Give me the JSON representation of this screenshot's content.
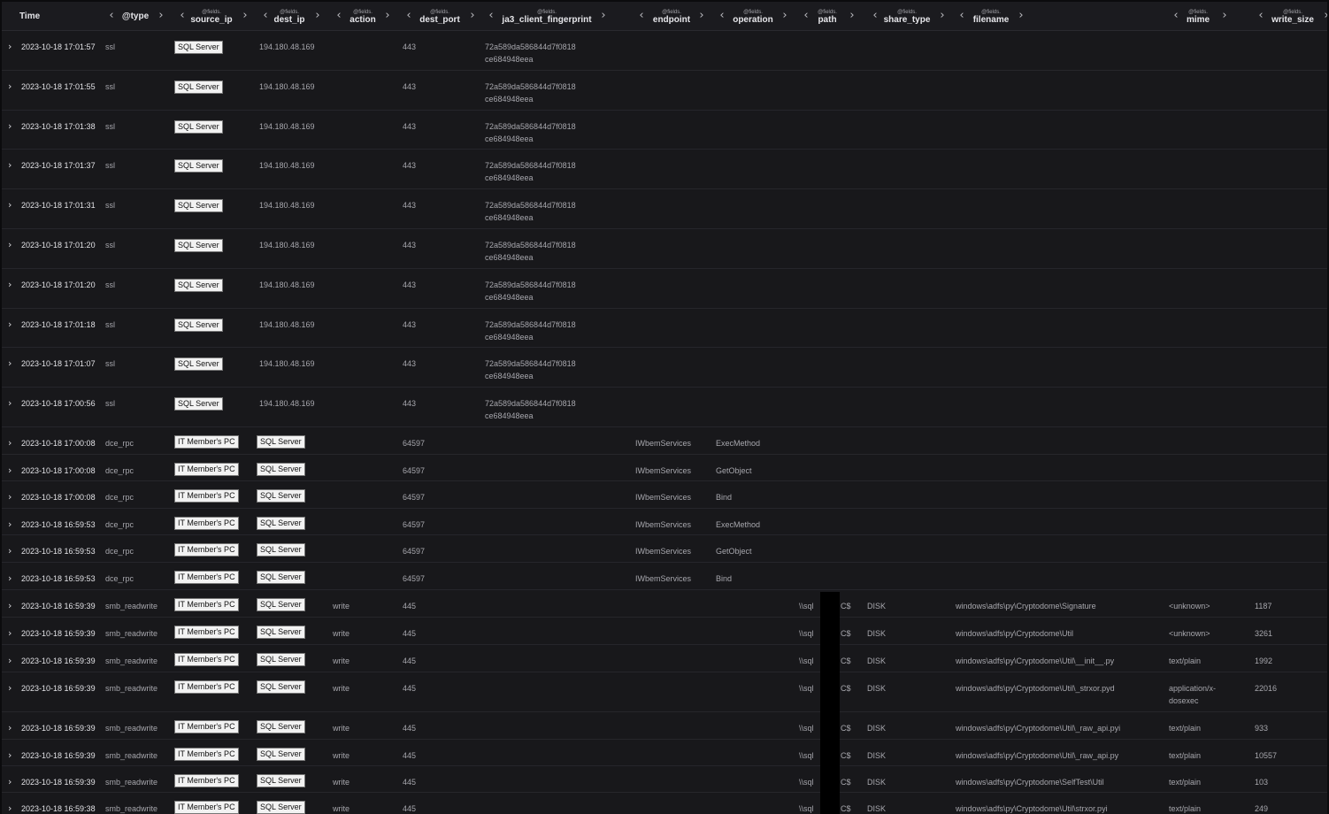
{
  "columns": [
    {
      "prefix": "",
      "name": "Time"
    },
    {
      "prefix": "",
      "name": "@type"
    },
    {
      "prefix": "@fields.",
      "name": "source_ip"
    },
    {
      "prefix": "@fields.",
      "name": "dest_ip"
    },
    {
      "prefix": "@fields.",
      "name": "action"
    },
    {
      "prefix": "@fields.",
      "name": "dest_port"
    },
    {
      "prefix": "@fields.",
      "name": "ja3_client_fingerprint"
    },
    {
      "prefix": "@fields.",
      "name": "endpoint"
    },
    {
      "prefix": "@fields.",
      "name": "operation"
    },
    {
      "prefix": "@fields.",
      "name": "path"
    },
    {
      "prefix": "@fields.",
      "name": "share_type"
    },
    {
      "prefix": "@fields.",
      "name": "filename"
    },
    {
      "prefix": "@fields.",
      "name": "mime"
    },
    {
      "prefix": "@fields.",
      "name": "write_size"
    }
  ],
  "ssl_rows": [
    {
      "time": "2023-10-18 17:01:57",
      "type": "ssl",
      "source": "SQL Server",
      "dest_ip": "194.180.48.169",
      "port": "443",
      "fp1": "72a589da586844d7f0818",
      "fp2": "ce684948eea"
    },
    {
      "time": "2023-10-18 17:01:55",
      "type": "ssl",
      "source": "SQL Server",
      "dest_ip": "194.180.48.169",
      "port": "443",
      "fp1": "72a589da586844d7f0818",
      "fp2": "ce684948eea"
    },
    {
      "time": "2023-10-18 17:01:38",
      "type": "ssl",
      "source": "SQL Server",
      "dest_ip": "194.180.48.169",
      "port": "443",
      "fp1": "72a589da586844d7f0818",
      "fp2": "ce684948eea"
    },
    {
      "time": "2023-10-18 17:01:37",
      "type": "ssl",
      "source": "SQL Server",
      "dest_ip": "194.180.48.169",
      "port": "443",
      "fp1": "72a589da586844d7f0818",
      "fp2": "ce684948eea"
    },
    {
      "time": "2023-10-18 17:01:31",
      "type": "ssl",
      "source": "SQL Server",
      "dest_ip": "194.180.48.169",
      "port": "443",
      "fp1": "72a589da586844d7f0818",
      "fp2": "ce684948eea"
    },
    {
      "time": "2023-10-18 17:01:20",
      "type": "ssl",
      "source": "SQL Server",
      "dest_ip": "194.180.48.169",
      "port": "443",
      "fp1": "72a589da586844d7f0818",
      "fp2": "ce684948eea"
    },
    {
      "time": "2023-10-18 17:01:20",
      "type": "ssl",
      "source": "SQL Server",
      "dest_ip": "194.180.48.169",
      "port": "443",
      "fp1": "72a589da586844d7f0818",
      "fp2": "ce684948eea"
    },
    {
      "time": "2023-10-18 17:01:18",
      "type": "ssl",
      "source": "SQL Server",
      "dest_ip": "194.180.48.169",
      "port": "443",
      "fp1": "72a589da586844d7f0818",
      "fp2": "ce684948eea"
    },
    {
      "time": "2023-10-18 17:01:07",
      "type": "ssl",
      "source": "SQL Server",
      "dest_ip": "194.180.48.169",
      "port": "443",
      "fp1": "72a589da586844d7f0818",
      "fp2": "ce684948eea"
    },
    {
      "time": "2023-10-18 17:00:56",
      "type": "ssl",
      "source": "SQL Server",
      "dest_ip": "194.180.48.169",
      "port": "443",
      "fp1": "72a589da586844d7f0818",
      "fp2": "ce684948eea"
    }
  ],
  "rpc_rows": [
    {
      "time": "2023-10-18 17:00:08",
      "type": "dce_rpc",
      "source": "IT Member's PC",
      "dest": "SQL Server",
      "port": "64597",
      "endpoint": "IWbemServices",
      "operation": "ExecMethod"
    },
    {
      "time": "2023-10-18 17:00:08",
      "type": "dce_rpc",
      "source": "IT Member's PC",
      "dest": "SQL Server",
      "port": "64597",
      "endpoint": "IWbemServices",
      "operation": "GetObject"
    },
    {
      "time": "2023-10-18 17:00:08",
      "type": "dce_rpc",
      "source": "IT Member's PC",
      "dest": "SQL Server",
      "port": "64597",
      "endpoint": "IWbemServices",
      "operation": "Bind"
    },
    {
      "time": "2023-10-18 16:59:53",
      "type": "dce_rpc",
      "source": "IT Member's PC",
      "dest": "SQL Server",
      "port": "64597",
      "endpoint": "IWbemServices",
      "operation": "ExecMethod"
    },
    {
      "time": "2023-10-18 16:59:53",
      "type": "dce_rpc",
      "source": "IT Member's PC",
      "dest": "SQL Server",
      "port": "64597",
      "endpoint": "IWbemServices",
      "operation": "GetObject"
    },
    {
      "time": "2023-10-18 16:59:53",
      "type": "dce_rpc",
      "source": "IT Member's PC",
      "dest": "SQL Server",
      "port": "64597",
      "endpoint": "IWbemServices",
      "operation": "Bind"
    }
  ],
  "smb_rows": [
    {
      "time": "2023-10-18 16:59:39",
      "type": "smb_readwrite",
      "source": "IT Member's PC",
      "dest": "SQL Server",
      "action": "write",
      "port": "445",
      "path_a": "\\\\sql",
      "path_b": "C$",
      "share": "DISK",
      "filename": "windows\\adfs\\py\\Cryptodome\\Signature",
      "mime1": "<unknown>",
      "mime2": "",
      "size": "1187"
    },
    {
      "time": "2023-10-18 16:59:39",
      "type": "smb_readwrite",
      "source": "IT Member's PC",
      "dest": "SQL Server",
      "action": "write",
      "port": "445",
      "path_a": "\\\\sql",
      "path_b": "C$",
      "share": "DISK",
      "filename": "windows\\adfs\\py\\Cryptodome\\Util",
      "mime1": "<unknown>",
      "mime2": "",
      "size": "3261"
    },
    {
      "time": "2023-10-18 16:59:39",
      "type": "smb_readwrite",
      "source": "IT Member's PC",
      "dest": "SQL Server",
      "action": "write",
      "port": "445",
      "path_a": "\\\\sql",
      "path_b": "C$",
      "share": "DISK",
      "filename": "windows\\adfs\\py\\Cryptodome\\Util\\__init__.py",
      "mime1": "text/plain",
      "mime2": "",
      "size": "1992"
    },
    {
      "time": "2023-10-18 16:59:39",
      "type": "smb_readwrite",
      "source": "IT Member's PC",
      "dest": "SQL Server",
      "action": "write",
      "port": "445",
      "path_a": "\\\\sql",
      "path_b": "C$",
      "share": "DISK",
      "filename": "windows\\adfs\\py\\Cryptodome\\Util\\_strxor.pyd",
      "mime1": "application/x-",
      "mime2": "dosexec",
      "size": "22016"
    },
    {
      "time": "2023-10-18 16:59:39",
      "type": "smb_readwrite",
      "source": "IT Member's PC",
      "dest": "SQL Server",
      "action": "write",
      "port": "445",
      "path_a": "\\\\sql",
      "path_b": "C$",
      "share": "DISK",
      "filename": "windows\\adfs\\py\\Cryptodome\\Util\\_raw_api.pyi",
      "mime1": "text/plain",
      "mime2": "",
      "size": "933"
    },
    {
      "time": "2023-10-18 16:59:39",
      "type": "smb_readwrite",
      "source": "IT Member's PC",
      "dest": "SQL Server",
      "action": "write",
      "port": "445",
      "path_a": "\\\\sql",
      "path_b": "C$",
      "share": "DISK",
      "filename": "windows\\adfs\\py\\Cryptodome\\Util\\_raw_api.py",
      "mime1": "text/plain",
      "mime2": "",
      "size": "10557"
    },
    {
      "time": "2023-10-18 16:59:39",
      "type": "smb_readwrite",
      "source": "IT Member's PC",
      "dest": "SQL Server",
      "action": "write",
      "port": "445",
      "path_a": "\\\\sql",
      "path_b": "C$",
      "share": "DISK",
      "filename": "windows\\adfs\\py\\Cryptodome\\SelfTest\\Util",
      "mime1": "text/plain",
      "mime2": "",
      "size": "103"
    },
    {
      "time": "2023-10-18 16:59:38",
      "type": "smb_readwrite",
      "source": "IT Member's PC",
      "dest": "SQL Server",
      "action": "write",
      "port": "445",
      "path_a": "\\\\sql",
      "path_b": "C$",
      "share": "DISK",
      "filename": "windows\\adfs\\py\\Cryptodome\\Util\\strxor.pyi",
      "mime1": "text/plain",
      "mime2": "",
      "size": "249"
    }
  ]
}
